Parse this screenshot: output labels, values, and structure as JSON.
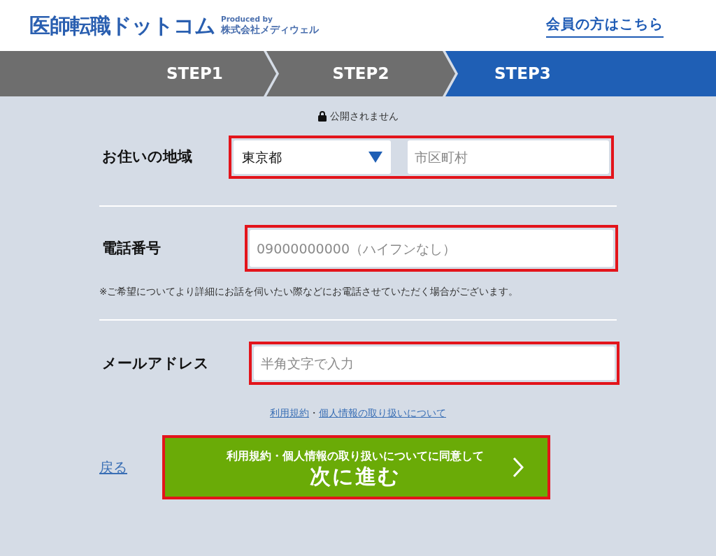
{
  "header": {
    "logo": "医師転職ドットコム",
    "produced_by": "Produced by",
    "company": "株式会社メディウェル",
    "member_link": "会員の方はこちら"
  },
  "steps": [
    {
      "label": "STEP1",
      "selected": false
    },
    {
      "label": "STEP2",
      "selected": false
    },
    {
      "label": "STEP3",
      "selected": true
    }
  ],
  "privacy_note": "公開されません",
  "fields": [
    {
      "kind": "region",
      "label": "お住いの地域",
      "select_value": "東京都",
      "placeholder": "市区町村",
      "highlighted": true
    },
    {
      "kind": "text",
      "label": "電話番号",
      "placeholder": "09000000000（ハイフンなし）",
      "highlighted": true,
      "note": "※ご希望についてより詳細にお話を伺いたい際などにお電話させていただく場合がございます。"
    },
    {
      "kind": "text",
      "label": "メールアドレス",
      "placeholder": "半角文字で入力",
      "highlighted": true
    }
  ],
  "policy_links": [
    {
      "label": "利用規約"
    },
    {
      "label": "個人情報の取り扱いについて"
    }
  ],
  "link_separator": "・",
  "back_link": "戻る",
  "submit": {
    "caption": "利用規約・個人情報の取り扱いについてに同意して",
    "label": "次に進む",
    "highlighted": true
  }
}
